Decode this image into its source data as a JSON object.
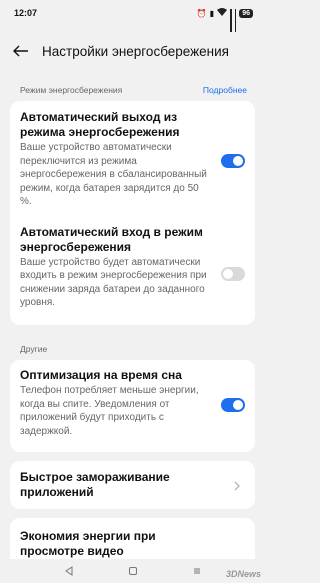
{
  "status": {
    "time": "12:07",
    "battery": "96"
  },
  "header": {
    "title": "Настройки энергосбережения"
  },
  "section1": {
    "label": "Режим энергосбережения",
    "more": "Подробнее"
  },
  "card1": {
    "item1": {
      "title": "Автоматический выход из режима энергосбережения",
      "desc": "Ваше устройство автоматически переключится из режима энергосбережения в сбалансированный режим, когда батарея зарядится до 50 %.",
      "enabled": true
    },
    "item2": {
      "title": "Автоматический вход в режим энергосбережения",
      "desc": "Ваше устройство будет автоматически входить в режим энергосбережения при снижении заряда батареи до заданного уровня.",
      "enabled": false
    }
  },
  "section2": {
    "label": "Другие"
  },
  "card2": {
    "title": "Оптимизация на время сна",
    "desc": "Телефон потребляет меньше энергии, когда вы спите. Уведомления от приложений будут приходить с задержкой.",
    "enabled": true
  },
  "card3": {
    "title": "Быстрое замораживание приложений"
  },
  "card4": {
    "title": "Экономия энергии при просмотре видео"
  },
  "watermark": "3DNews"
}
